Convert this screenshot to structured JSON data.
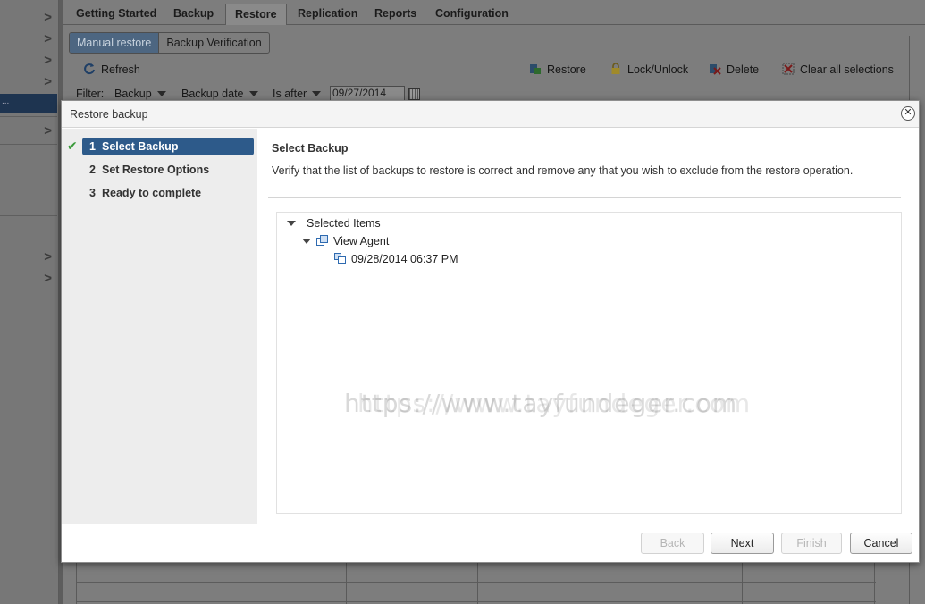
{
  "tabs": [
    "Getting Started",
    "Backup",
    "Restore",
    "Replication",
    "Reports",
    "Configuration"
  ],
  "active_tab": "Restore",
  "subtabs": {
    "manual": "Manual restore",
    "verification": "Backup Verification"
  },
  "toolbar": {
    "refresh": "Refresh",
    "restore": "Restore",
    "lock": "Lock/Unlock",
    "delete": "Delete",
    "clear": "Clear all selections"
  },
  "filter": {
    "label": "Filter:",
    "field": "Backup",
    "date_field": "Backup date",
    "operator": "Is after",
    "date_value": "09/27/2014"
  },
  "left_nav": {
    "selected_label": "..."
  },
  "dialog": {
    "title": "Restore backup",
    "close_glyph": "✕",
    "steps": [
      {
        "num": "1",
        "label": "Select Backup"
      },
      {
        "num": "2",
        "label": "Set Restore Options"
      },
      {
        "num": "3",
        "label": "Ready to complete"
      }
    ],
    "content_title": "Select Backup",
    "content_desc": "Verify that the list of backups to restore is correct and remove any that you wish to exclude from the restore operation.",
    "tree": {
      "root": "Selected Items",
      "vm": "View Agent",
      "backup": "09/28/2014 06:37 PM"
    },
    "buttons": {
      "back": "Back",
      "next": "Next",
      "finish": "Finish",
      "cancel": "Cancel"
    }
  },
  "watermark": "https://www.tayfundeger.com",
  "colors": {
    "accent": "#2d5a8a",
    "check": "#3a9a3a",
    "selected_nav": "#1e3450"
  }
}
